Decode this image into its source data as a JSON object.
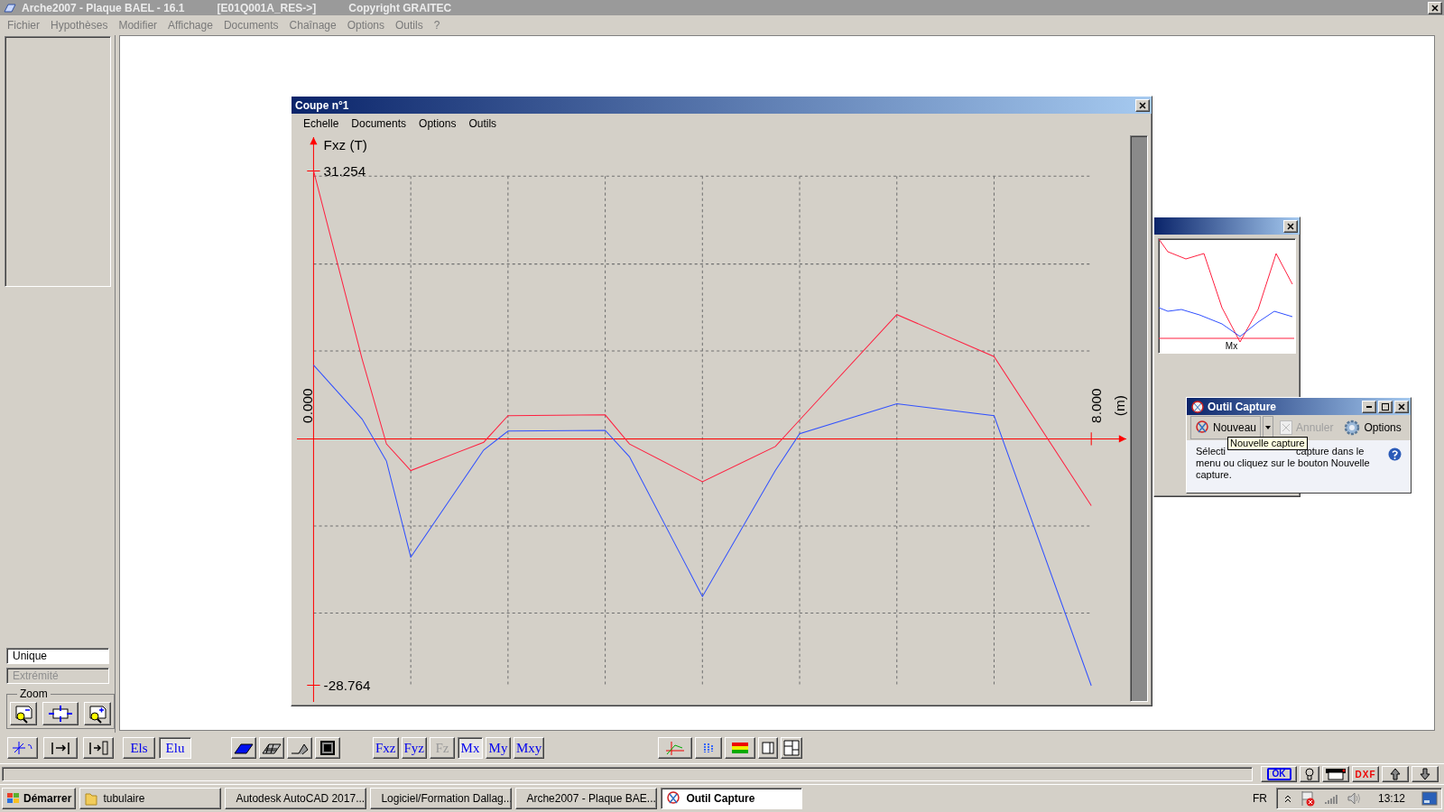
{
  "window": {
    "title": "Arche2007 - Plaque BAEL - 16.1",
    "file": "[E01Q001A_RES->]",
    "copyright": "Copyright GRAITEC"
  },
  "menu": [
    "Fichier",
    "Hypothèses",
    "Modifier",
    "Affichage",
    "Documents",
    "Chaînage",
    "Options",
    "Outils",
    "?"
  ],
  "left_panel": {
    "fields": [
      {
        "value": "Unique",
        "disabled": false
      },
      {
        "value": "Extrémité",
        "disabled": true
      }
    ],
    "zoom_label": "Zoom"
  },
  "coupe": {
    "title": "Coupe n°1",
    "menu": [
      "Echelle",
      "Documents",
      "Options",
      "Outils"
    ],
    "chart_data": {
      "type": "line",
      "ylabel": "Fxz (T)",
      "annotations": [
        "(m)"
      ],
      "x": [
        0,
        0.5,
        0.75,
        1,
        1.75,
        2,
        3,
        3.25,
        4,
        4.75,
        5,
        6,
        7,
        8
      ],
      "xlim": [
        -0.19,
        8.36
      ],
      "ylim": [
        -30.7,
        35.2
      ],
      "xticks": [
        {
          "value": 0,
          "label": "0.000"
        },
        {
          "value": 8,
          "label": "8.000"
        }
      ],
      "yticks": [
        {
          "value": 31.254,
          "label": "31.254"
        },
        {
          "value": -28.764,
          "label": "-28.764"
        }
      ],
      "series": [
        {
          "color": "#ff2040",
          "values": [
            31.3,
            9.3,
            -0.6,
            -3.7,
            -0.4,
            2.7,
            2.8,
            -0.6,
            -5.0,
            -0.9,
            2.2,
            14.5,
            9.6,
            -7.8
          ]
        },
        {
          "color": "#3050ff",
          "values": [
            8.6,
            2.3,
            -2.6,
            -13.8,
            -1.3,
            0.9,
            1.0,
            -2.1,
            -18.4,
            -3.7,
            0.6,
            4.1,
            2.7,
            -28.8
          ]
        }
      ]
    }
  },
  "back_window": {
    "chart_label": "Mx"
  },
  "capture": {
    "title": "Outil Capture",
    "new_button": "Nouveau",
    "cancel_button": {
      "label": "Annuler",
      "disabled": true
    },
    "options_button": "Options",
    "tooltip": "Nouvelle capture",
    "text_before": "Sélecti",
    "text_after": "capture dans le menu ou cliquez sur le bouton Nouvelle capture."
  },
  "load_cases": [
    {
      "label": "Els",
      "selected": false
    },
    {
      "label": "Elu",
      "selected": true
    }
  ],
  "results": [
    {
      "label": "Fxz",
      "selected": false,
      "disabled": false
    },
    {
      "label": "Fyz",
      "selected": false,
      "disabled": false
    },
    {
      "label": "Fz",
      "selected": false,
      "disabled": true
    },
    {
      "label": "Mx",
      "selected": true,
      "disabled": false
    },
    {
      "label": "My",
      "selected": false,
      "disabled": false
    },
    {
      "label": "Mxy",
      "selected": false,
      "disabled": false
    }
  ],
  "status_bar": {
    "ok": "OK",
    "export": "DXF"
  },
  "taskbar": {
    "start": "Démarrer",
    "tasks": [
      {
        "label": "tubulaire",
        "kind": "folder",
        "selected": false
      },
      {
        "label": "Autodesk AutoCAD 2017...",
        "kind": "autocad",
        "selected": false
      },
      {
        "label": "Logiciel/Formation Dallag...",
        "kind": "browser",
        "selected": false
      },
      {
        "label": "Arche2007 - Plaque BAE...",
        "kind": "arche",
        "selected": false
      },
      {
        "label": "Outil Capture",
        "kind": "capture",
        "selected": true
      }
    ],
    "language": "FR",
    "clock": "13:12"
  }
}
